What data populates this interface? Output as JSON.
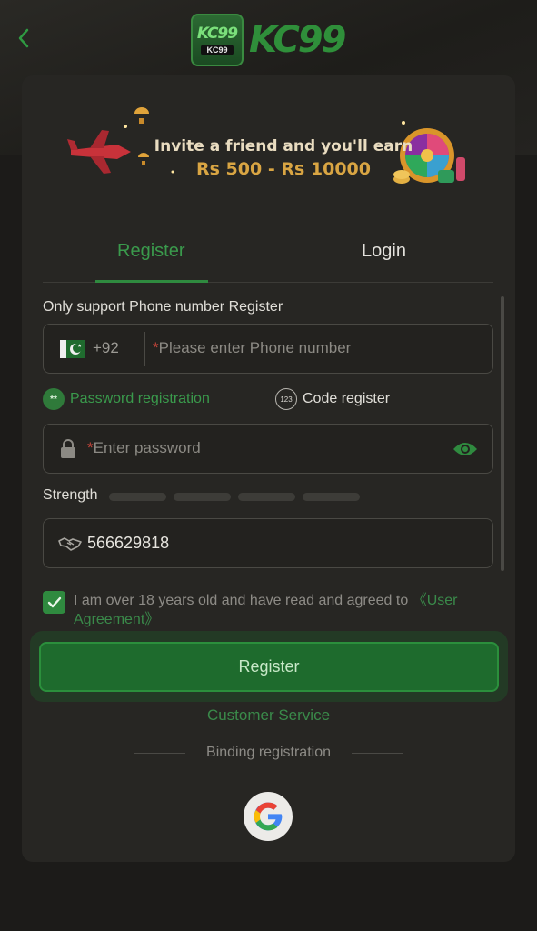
{
  "header": {
    "logo_badge_text": "KC99",
    "logo_badge_small": "KC99",
    "logo_text": "KC99"
  },
  "banner": {
    "line1": "Invite a friend and you'll earn",
    "line2": "Rs 500 - Rs 10000"
  },
  "tabs": [
    {
      "label": "Register",
      "active": true
    },
    {
      "label": "Login",
      "active": false
    }
  ],
  "form": {
    "support_label": "Only support Phone number Register",
    "phone_prefix": "+92",
    "phone_placeholder": "Please enter Phone number",
    "password_registration_label": "Password registration",
    "code_register_label": "Code register",
    "code_icon_text": "123",
    "password_placeholder": "Enter password",
    "strength_label": "Strength",
    "invite_code_value": "566629818",
    "agree_text": "I am over 18 years old and have read and agreed to ",
    "agree_link": "《User Agreement》",
    "register_button": "Register",
    "customer_service": "Customer Service",
    "binding_registration": "Binding registration"
  },
  "colors": {
    "accent_green": "#2f8a3f",
    "background": "#1c1b19",
    "card": "#272623"
  },
  "icons": [
    "back-chevron-icon",
    "pakistan-flag-icon",
    "lock-icon",
    "eye-icon",
    "handshake-icon",
    "check-icon",
    "google-icon"
  ]
}
